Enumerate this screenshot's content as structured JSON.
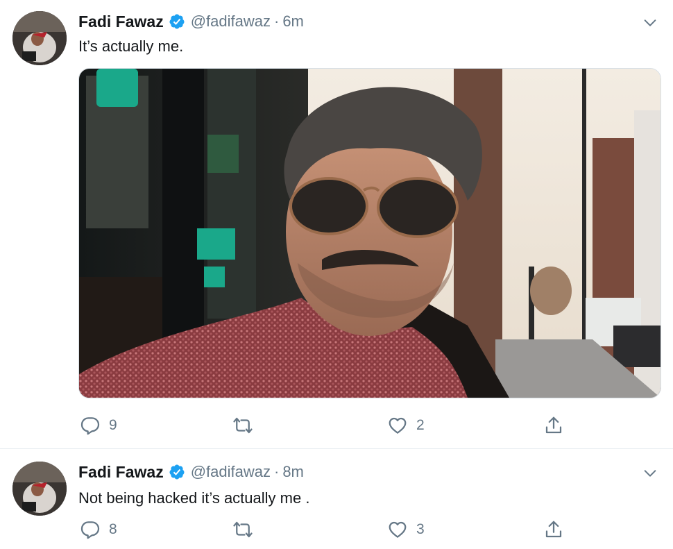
{
  "tweets": [
    {
      "user": {
        "name": "Fadi Fawaz",
        "handle": "@fadifawaz",
        "verified": true
      },
      "time": "6m",
      "separator": "·",
      "text": "It’s actually me.",
      "media": {
        "type": "photo"
      },
      "actions": {
        "replies": "9",
        "retweets": "",
        "likes": "2"
      },
      "icons": [
        "verified-badge-icon",
        "chevron-down-icon",
        "reply-icon",
        "retweet-icon",
        "like-icon",
        "share-icon"
      ]
    },
    {
      "user": {
        "name": "Fadi Fawaz",
        "handle": "@fadifawaz",
        "verified": true
      },
      "time": "8m",
      "separator": "·",
      "text": "Not being hacked it’s actually me .",
      "actions": {
        "replies": "8",
        "retweets": "",
        "likes": "3"
      },
      "icons": [
        "verified-badge-icon",
        "chevron-down-icon",
        "reply-icon",
        "retweet-icon",
        "like-icon",
        "share-icon"
      ]
    }
  ],
  "colors": {
    "verified": "#1da1f2",
    "muted": "#657786",
    "text": "#14171a",
    "divider": "#e6ecf0"
  }
}
